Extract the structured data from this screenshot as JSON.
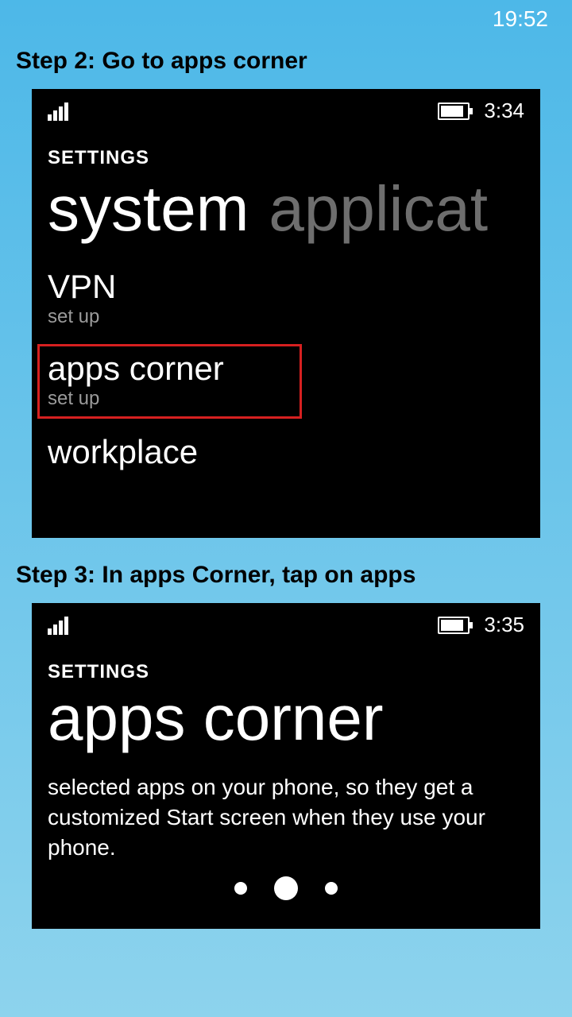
{
  "outer_status": {
    "time": "19:52"
  },
  "step2": {
    "heading": "Step 2: Go to apps corner",
    "phone_time": "3:34",
    "settings_label": "SETTINGS",
    "tab_active": "system",
    "tab_inactive": "applicat",
    "items": [
      {
        "title": "VPN",
        "subtitle": "set up"
      },
      {
        "title": "apps corner",
        "subtitle": "set up"
      },
      {
        "title": "workplace",
        "subtitle": ""
      }
    ]
  },
  "step3": {
    "heading": "Step 3: In apps Corner, tap on apps",
    "phone_time": "3:35",
    "settings_label": "SETTINGS",
    "page_title": "apps corner",
    "description": "selected apps on your phone, so they get a customized Start screen when they use your phone."
  }
}
